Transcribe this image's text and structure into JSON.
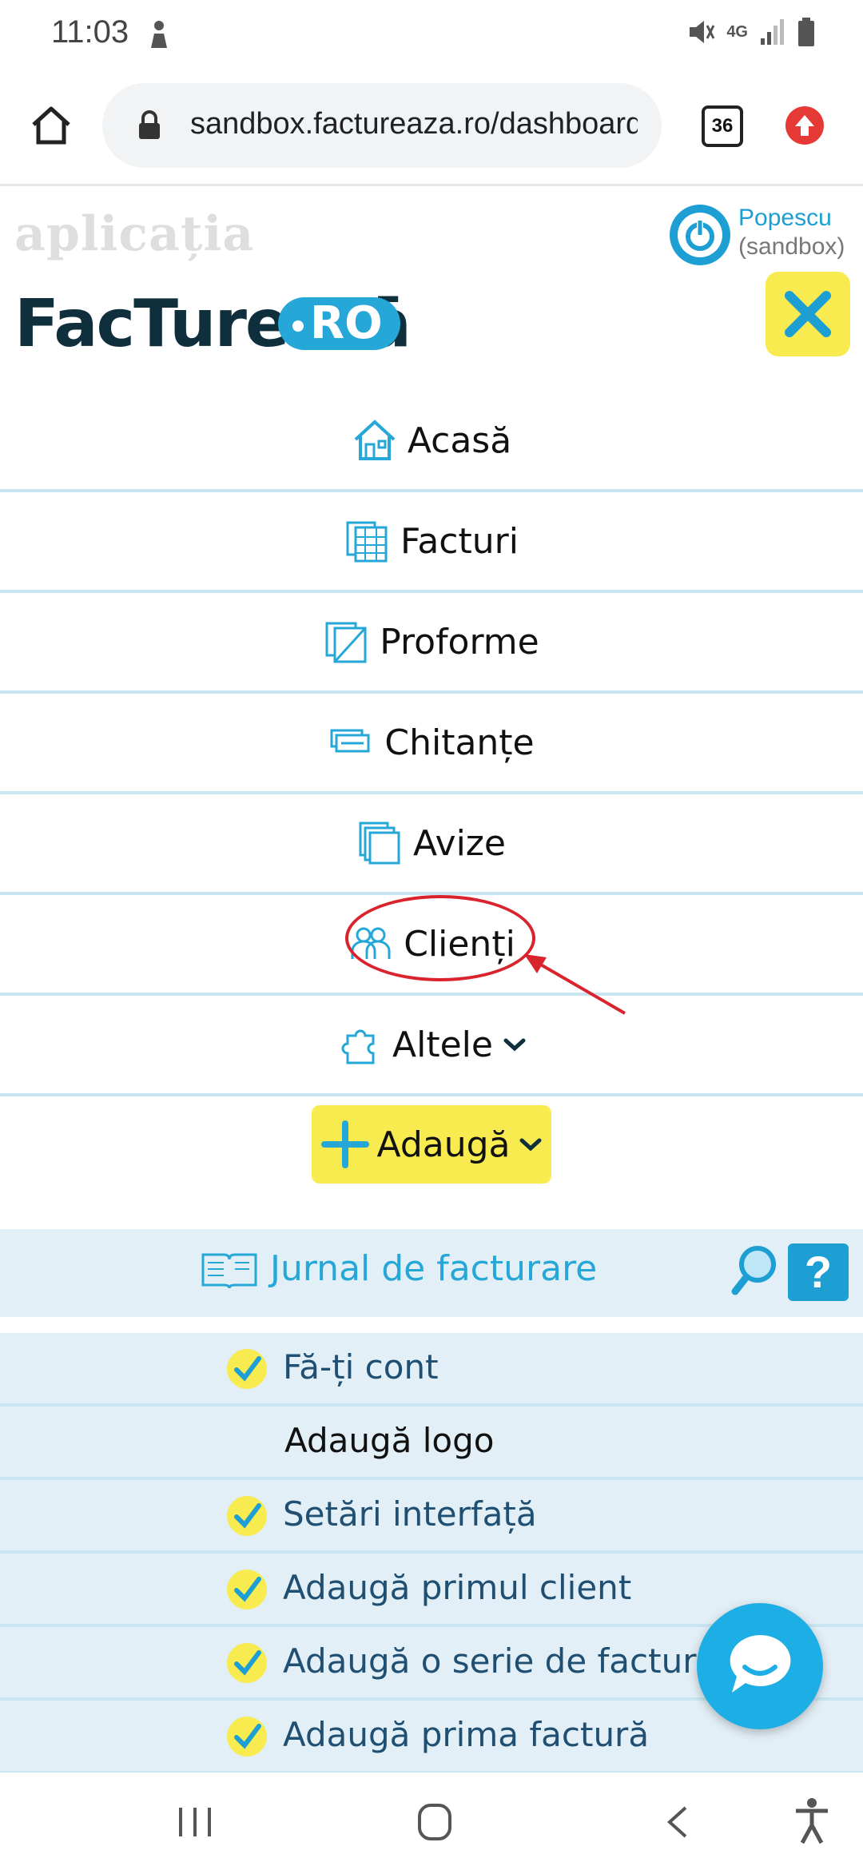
{
  "status_bar": {
    "time": "11:03",
    "network": "4G"
  },
  "browser": {
    "url": "sandbox.factureaza.ro/dashboard",
    "tab_count": "36"
  },
  "header": {
    "tagline": "aplicația",
    "brand": "FacTureazā",
    "brand_suffix": "RO",
    "user_name": "Popescu",
    "user_env": "(sandbox)"
  },
  "menu": {
    "items": [
      {
        "label": "Acasă",
        "icon": "home-icon"
      },
      {
        "label": "Facturi",
        "icon": "invoices-icon"
      },
      {
        "label": "Proforme",
        "icon": "proforma-icon"
      },
      {
        "label": "Chitanțe",
        "icon": "receipts-icon"
      },
      {
        "label": "Avize",
        "icon": "delivery-notes-icon"
      },
      {
        "label": "Clienți",
        "icon": "clients-icon"
      },
      {
        "label": "Altele",
        "icon": "puzzle-icon"
      }
    ]
  },
  "add_button": {
    "label": "Adaugă"
  },
  "journal": {
    "title": "Jurnal de facturare",
    "help_label": "?",
    "items": [
      {
        "label": "Fă-ți cont",
        "done": true
      },
      {
        "label": "Adaugă logo",
        "done": false
      },
      {
        "label": "Setări interfață",
        "done": true
      },
      {
        "label": "Adaugă primul client",
        "done": true
      },
      {
        "label": "Adaugă o serie de facturi",
        "done": true
      },
      {
        "label": "Adaugă prima factură",
        "done": true
      }
    ]
  },
  "colors": {
    "accent": "#25a7d8",
    "yellow": "#f8eb4f",
    "annotation": "#d9232d"
  }
}
